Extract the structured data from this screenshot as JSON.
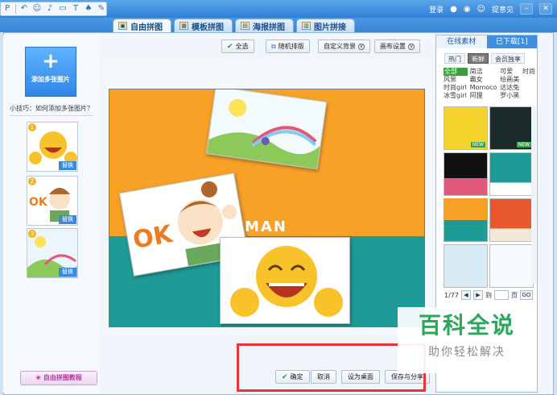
{
  "titlebar": {
    "quick_tools": [
      "P",
      "↶",
      "☺",
      "♪",
      "▭",
      "T",
      "♠",
      "✎"
    ],
    "login": "登录",
    "feedback": "提意见"
  },
  "tabs": [
    {
      "label": "自由拼图",
      "active": true
    },
    {
      "label": "模板拼图",
      "active": false
    },
    {
      "label": "海报拼图",
      "active": false
    },
    {
      "label": "图片拼接",
      "active": false
    }
  ],
  "left": {
    "add_label": "添加多张图片",
    "tip": "小技巧：如何添加多张图片？",
    "thumbs": [
      {
        "num": "1",
        "replace": "替换"
      },
      {
        "num": "2",
        "replace": "替换"
      },
      {
        "num": "3",
        "replace": "替换"
      }
    ],
    "tutorial": "自由拼图教程"
  },
  "toolbar": {
    "select_all": "全选",
    "random": "随机排版",
    "custom_bg": "自定义背景",
    "canvas_settings": "画布设置"
  },
  "canvas": {
    "ok_text": "OK",
    "man_text": "MAN"
  },
  "bottom": {
    "confirm": "确定",
    "cancel": "取消",
    "set_desktop": "设为桌面",
    "save_share": "保存与分享"
  },
  "right": {
    "tab_online": "在线素材",
    "tab_downloaded": "已下载[1]",
    "filters": [
      "热门",
      "新鲜",
      "会员独享"
    ],
    "categories": [
      "全部",
      "简洁",
      "可爱",
      "时尚",
      "风景",
      "霸女",
      "绘画美",
      "",
      "时尚girl",
      "Momoco",
      "达达兔",
      "",
      "冰雪girl",
      "阿狸",
      "罗小黑",
      ""
    ],
    "new_badge": "NEW",
    "page": "1/77",
    "goto": "到",
    "page_unit": "页",
    "go": "GO"
  },
  "watermark": {
    "main": "百科全说",
    "sub": "助你轻松解决"
  },
  "colors": {
    "canvas_teal": "#1e9b97",
    "canvas_orange": "#f7a127",
    "highlight_red": "#e9333b",
    "watermark_green": "#27a85a"
  }
}
